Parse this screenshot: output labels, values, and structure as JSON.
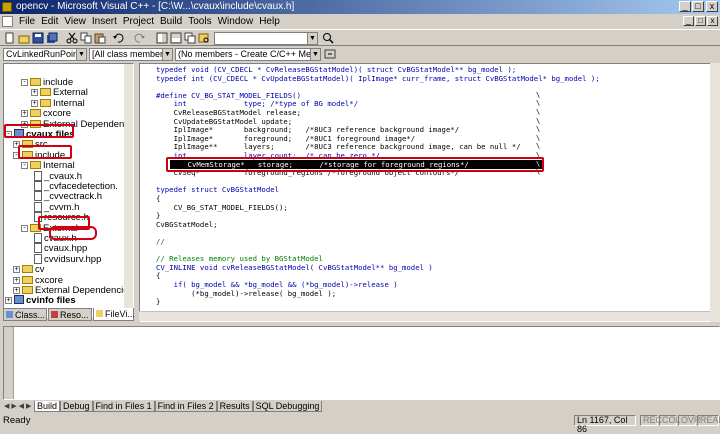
{
  "window": {
    "title": "opencv - Microsoft Visual C++ - [C:\\W...\\cvaux\\include\\cvaux.h]",
    "controls": [
      "_",
      "□",
      "x"
    ]
  },
  "menubar": {
    "items": [
      "File",
      "Edit",
      "View",
      "Insert",
      "Project",
      "Build",
      "Tools",
      "Window",
      "Help"
    ]
  },
  "wizardbar": {
    "class_combo": "CvLinkedRunPoint",
    "members_combo": "[All class members]",
    "function_combo": "(No members - Create C/C++ Memb"
  },
  "workspace": {
    "tree": [
      {
        "label": "include",
        "kind": "folder",
        "level": 3,
        "exp": "-"
      },
      {
        "label": "External",
        "kind": "folder",
        "level": 4,
        "exp": "+"
      },
      {
        "label": "Internal",
        "kind": "folder",
        "level": 4,
        "exp": "+"
      },
      {
        "label": "cxcore",
        "kind": "folder",
        "level": 3,
        "exp": "+"
      },
      {
        "label": "External Dependencies",
        "kind": "folder",
        "level": 3,
        "exp": "+"
      },
      {
        "label": "cvaux files",
        "kind": "project",
        "level": 1,
        "exp": "-"
      },
      {
        "label": "src",
        "kind": "folder",
        "level": 2,
        "exp": "+"
      },
      {
        "label": "include",
        "kind": "folder",
        "level": 2,
        "exp": "-"
      },
      {
        "label": "Internal",
        "kind": "folder",
        "level": 3,
        "exp": "-"
      },
      {
        "label": "_cvaux.h",
        "kind": "file",
        "level": 4,
        "exp": ""
      },
      {
        "label": "_cvfacedetection.",
        "kind": "file",
        "level": 4,
        "exp": ""
      },
      {
        "label": "_cvvectrack.h",
        "kind": "file",
        "level": 4,
        "exp": ""
      },
      {
        "label": "_cvvm.h",
        "kind": "file",
        "level": 4,
        "exp": ""
      },
      {
        "label": "resource.h",
        "kind": "file",
        "level": 4,
        "exp": ""
      },
      {
        "label": "External",
        "kind": "folder",
        "level": 3,
        "exp": "-"
      },
      {
        "label": "cvaux.h",
        "kind": "file",
        "level": 4,
        "exp": ""
      },
      {
        "label": "cvaux.hpp",
        "kind": "file",
        "level": 4,
        "exp": ""
      },
      {
        "label": "cvvidsurv.hpp",
        "kind": "file",
        "level": 4,
        "exp": ""
      },
      {
        "label": "cv",
        "kind": "folder",
        "level": 2,
        "exp": "+"
      },
      {
        "label": "cxcore",
        "kind": "folder",
        "level": 2,
        "exp": "+"
      },
      {
        "label": "External Dependencies",
        "kind": "folder",
        "level": 2,
        "exp": "+"
      },
      {
        "label": "cvinfo files",
        "kind": "project",
        "level": 1,
        "exp": "+"
      }
    ],
    "tabs": [
      "Class...",
      "Reso...",
      "FileVi..."
    ]
  },
  "editor": {
    "lines": [
      "typedef void (CV_CDECL * CvReleaseBGStatModel)( struct CvBGStatModel** bg_model );",
      "typedef int (CV_CDECL * CvUpdateBGStatModel)( IplImage* curr_frame, struct CvBGStatModel* bg_model );",
      "",
      "#define CV_BG_STAT_MODEL_FIELDS()",
      "    int             type; /*type of BG model*/",
      "    CvReleaseBGStatModel release;",
      "    CvUpdateBGStatModel update;",
      "    IplImage*       background;   /*8UC3 reference background image*/",
      "    IplImage*       foreground;   /*8UC1 foreground image*/",
      "    IplImage**      layers;       /*8UC3 reference background image, can be null */",
      "    int             layer_count;  /* can be zero */",
      "    CvMemStorage*   storage;      /*storage for foreground_regions*/",
      "    CvSeq*          foreground_regions /*foreground object contours*/",
      "",
      "typedef struct CvBGStatModel",
      "{",
      "    CV_BG_STAT_MODEL_FIELDS();",
      "}",
      "CvBGStatModel;",
      "",
      "//",
      "",
      "// Releases memory used by BGStatModel",
      "CV_INLINE void cvReleaseBGStatModel( CvBGStatModel** bg_model )",
      "{",
      "    if( bg_model && *bg_model && (*bg_model)->release )",
      "        (*bg_model)->release( bg_model );",
      "}",
      ""
    ],
    "eol_marker": "\\"
  },
  "output": {
    "tabs": [
      "Build",
      "Debug",
      "Find in Files 1",
      "Find in Files 2",
      "Results",
      "SQL Debugging"
    ],
    "active_tab": 0
  },
  "statusbar": {
    "text": "Ready",
    "position": "Ln 1167, Col 86",
    "indicators": [
      "REC",
      "COL",
      "OVR",
      "READ"
    ]
  }
}
